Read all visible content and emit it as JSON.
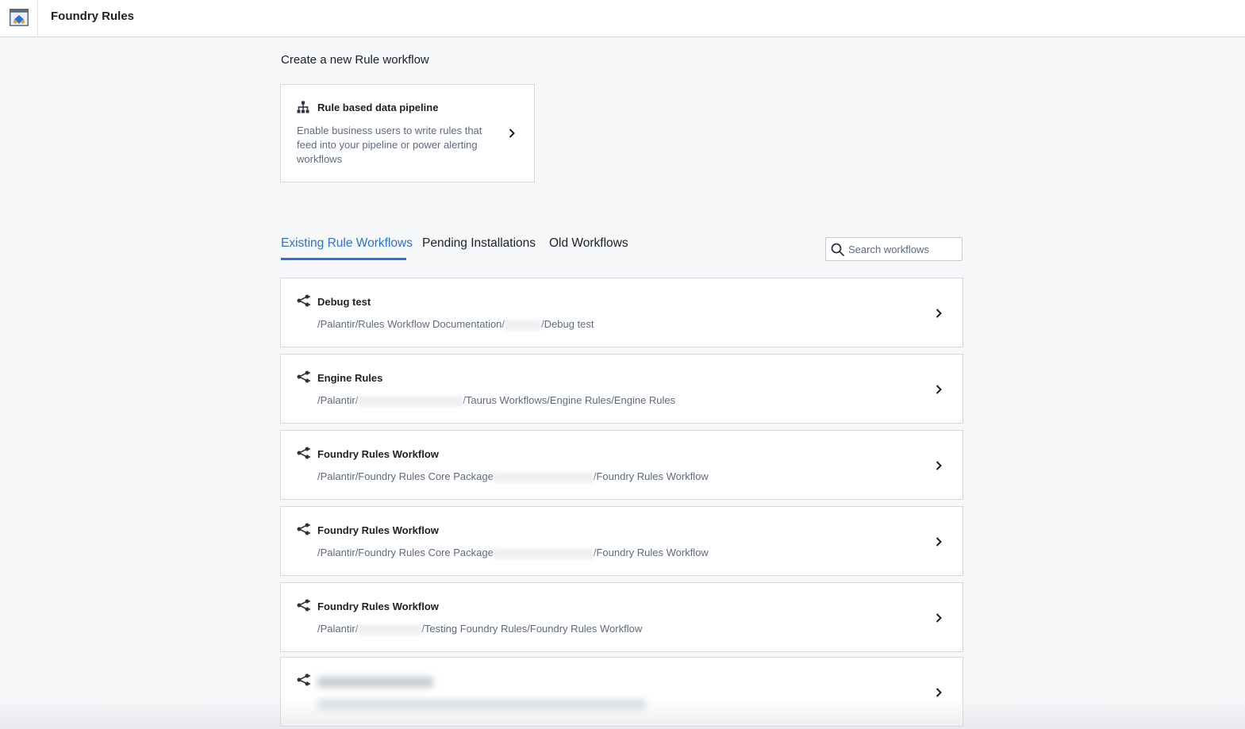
{
  "app": {
    "title": "Foundry Rules",
    "icon": "foundry-rules-app-icon"
  },
  "create": {
    "heading": "Create a new Rule workflow",
    "card": {
      "icon": "hierarchy-icon",
      "title": "Rule based data pipeline",
      "description": "Enable business users to write rules that feed into your pipeline or power alerting workflows"
    }
  },
  "tabs": [
    {
      "label": "Existing Rule Workflows",
      "active": true
    },
    {
      "label": "Pending Installations",
      "active": false
    },
    {
      "label": "Old Workflows",
      "active": false
    }
  ],
  "search": {
    "placeholder": "Search workflows",
    "value": ""
  },
  "workflows": [
    {
      "icon": "workflow-share-icon",
      "title": "Debug test",
      "path_prefix": "/Palantir/Rules Workflow Documentation/",
      "path_suffix": "/Debug test"
    },
    {
      "icon": "workflow-share-icon",
      "title": "Engine Rules",
      "path_prefix": "/Palantir/",
      "path_suffix": "/Taurus Workflows/Engine Rules/Engine Rules"
    },
    {
      "icon": "workflow-share-icon",
      "title": "Foundry Rules Workflow",
      "path_prefix": "/Palantir/Foundry Rules Core Package",
      "path_suffix": "/Foundry Rules Workflow"
    },
    {
      "icon": "workflow-share-icon",
      "title": "Foundry Rules Workflow",
      "path_prefix": "/Palantir/Foundry Rules Core Package",
      "path_suffix": "/Foundry Rules Workflow"
    },
    {
      "icon": "workflow-share-icon",
      "title": "Foundry Rules Workflow",
      "path_prefix": "/Palantir/",
      "path_suffix": "/Testing Foundry Rules/Foundry Rules Workflow"
    }
  ],
  "colors": {
    "accent": "#2d72d2",
    "text": "#1c2127",
    "muted": "#5f6b7c",
    "background": "#f6f7f9",
    "border": "#d3d8de"
  }
}
